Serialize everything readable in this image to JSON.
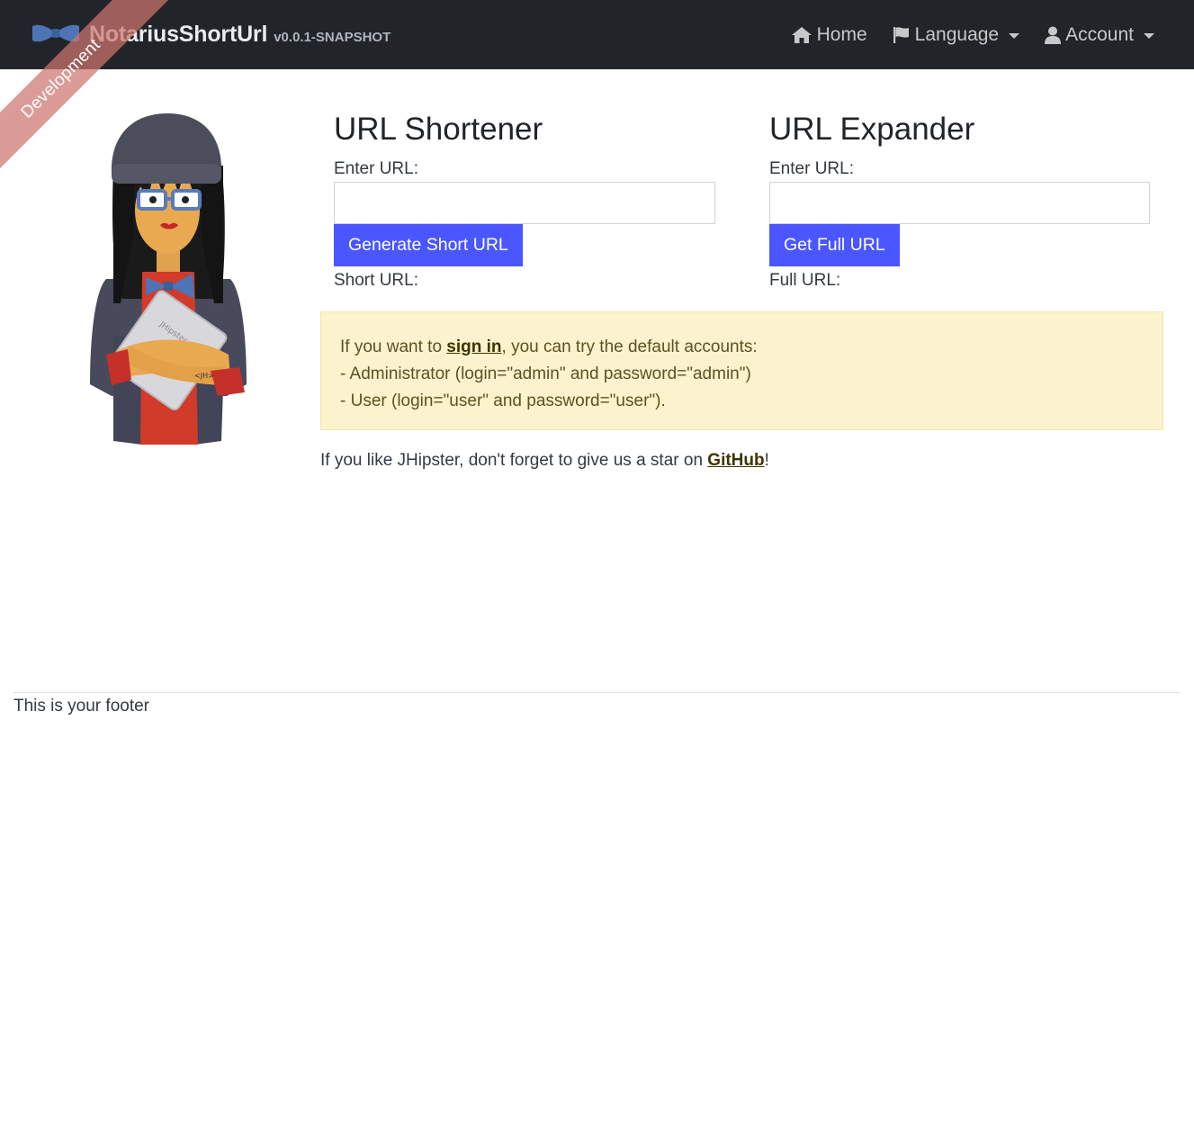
{
  "brand": {
    "title": "NotariusShortUrl",
    "version": "v0.0.1-SNAPSHOT",
    "ribbon": "Development"
  },
  "nav": {
    "home": "Home",
    "language": "Language",
    "account": "Account"
  },
  "shortener": {
    "title": "URL Shortener",
    "input_label": "Enter URL:",
    "input_value": "",
    "button_label": "Generate Short URL",
    "result_label": "Short URL:"
  },
  "expander": {
    "title": "URL Expander",
    "input_label": "Enter URL:",
    "input_value": "",
    "button_label": "Get Full URL",
    "result_label": "Full URL:"
  },
  "alert": {
    "prefix": "If you want to ",
    "link": "sign in",
    "suffix": ", you can try the default accounts:",
    "line2": "- Administrator (login=\"admin\" and password=\"admin\")",
    "line3": "- User (login=\"user\" and password=\"user\")."
  },
  "star": {
    "prefix": "If you like JHipster, don't forget to give us a star on ",
    "link": "GitHub",
    "suffix": "!"
  },
  "footer": {
    "text": "This is your footer"
  },
  "colors": {
    "navbar": "#212529",
    "primary_button": "#4a56ff",
    "alert_bg": "#faf3cd",
    "ribbon": "#cd7570"
  },
  "icons": {
    "home": "home-icon",
    "language": "flag-icon",
    "account": "user-icon"
  }
}
